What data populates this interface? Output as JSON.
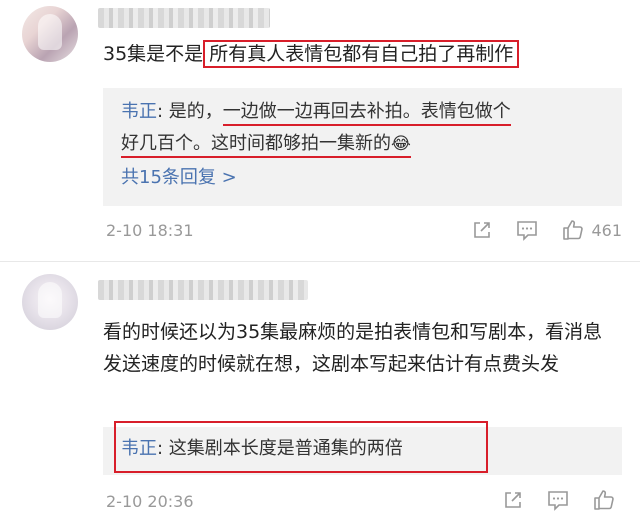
{
  "comments": [
    {
      "content_prefix": "35集是不是",
      "content_highlight": "所有真人表情包都有自己拍了再制作",
      "reply": {
        "author": "韦正",
        "sep": ": ",
        "text_a": "是的，",
        "text_b_underlined": "一边做一边再回去补拍。表情包做个",
        "text_c_underlined": "好几百个。这时间都够拍一集新的",
        "emoji": "😂",
        "more_label": "共15条回复 >"
      },
      "time": "2-10 18:31",
      "likes": "461"
    },
    {
      "content": "看的时候还以为35集最麻烦的是拍表情包和写剧本，看消息发送速度的时候就在想，这剧本写起来估计有点费头发",
      "reply": {
        "author": "韦正",
        "sep": ": ",
        "text": "这集剧本长度是普通集的两倍"
      },
      "time": "2-10 20:36",
      "likes": ""
    }
  ],
  "icons": {
    "share": "share-icon",
    "comment": "comment-icon",
    "like": "like-icon"
  },
  "colors": {
    "highlight_red": "#d81e2a",
    "link_blue": "#4a73b0",
    "reply_bg": "#f2f2f2",
    "meta_gray": "#999999"
  }
}
